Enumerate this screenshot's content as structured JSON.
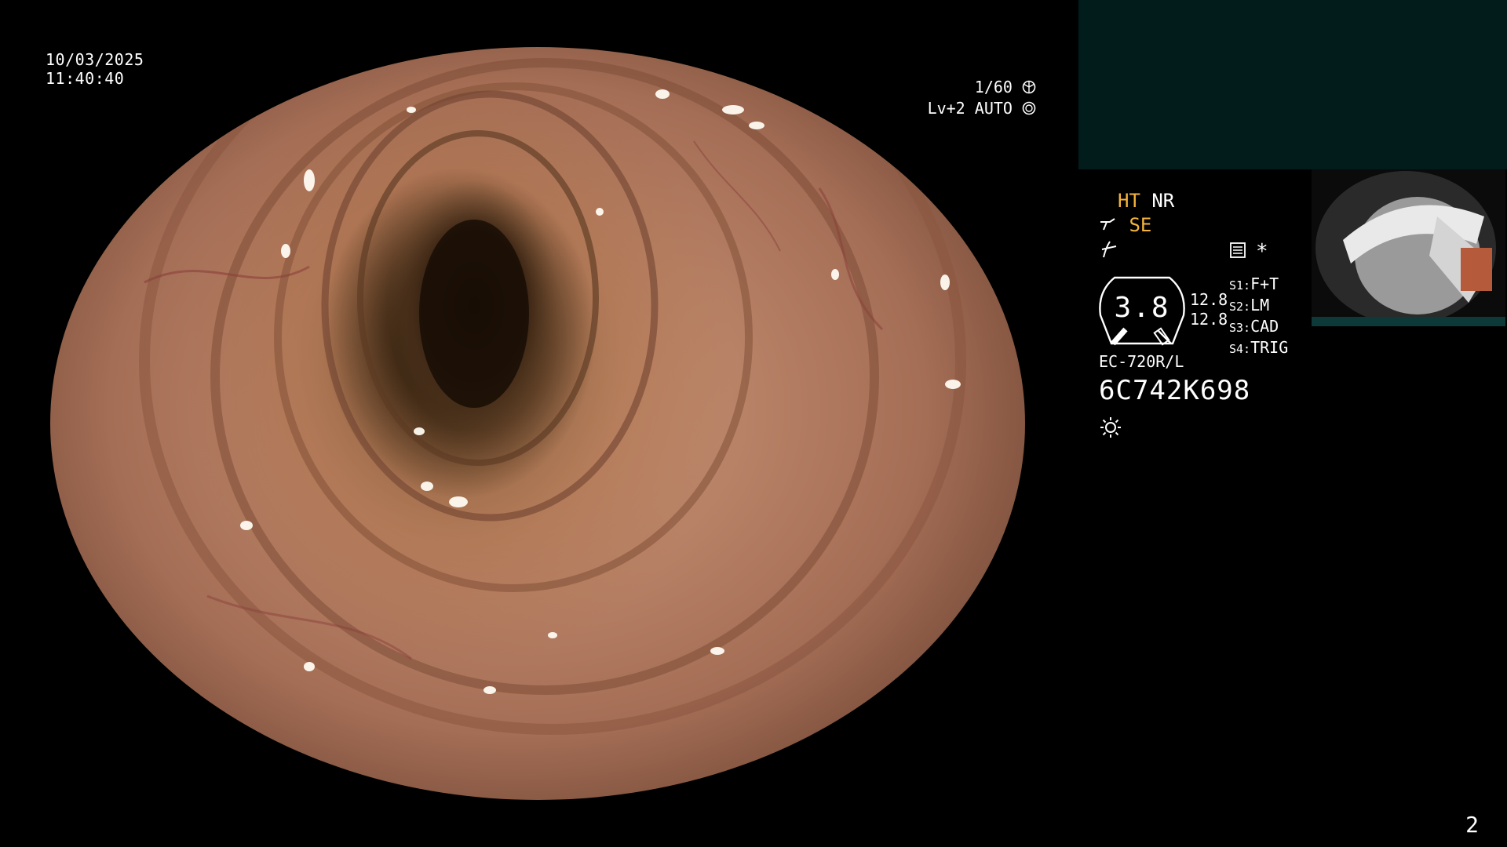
{
  "overlay": {
    "date": "10/03/2025",
    "time": "11:40:40",
    "shutter": "1/60",
    "level": "Lv+2",
    "iris_mode": "AUTO"
  },
  "enhancement": {
    "ht_label": "HT",
    "nr_label": "NR",
    "se_label": "SE"
  },
  "sector_value": "3.8",
  "depth_values": [
    "12.8",
    "12.8"
  ],
  "switches": [
    {
      "key": "S1:",
      "label": "F+T"
    },
    {
      "key": "S2:",
      "label": "LM"
    },
    {
      "key": "S3:",
      "label": "CAD"
    },
    {
      "key": "S4:",
      "label": "TRIG"
    }
  ],
  "scope_model": "EC-720R/L",
  "scope_serial": "6C742K698",
  "page_number": "2",
  "icons": [
    "shutter-icon",
    "iris-icon",
    "scope-tip-icon",
    "frequency-icon",
    "memo-icon",
    "asterisk-icon",
    "light-source-icon"
  ],
  "colors": {
    "background": "#000000",
    "overlay_text": "#ffffff",
    "highlight": "#f5b43c",
    "pip_panel": "#011c1b"
  }
}
